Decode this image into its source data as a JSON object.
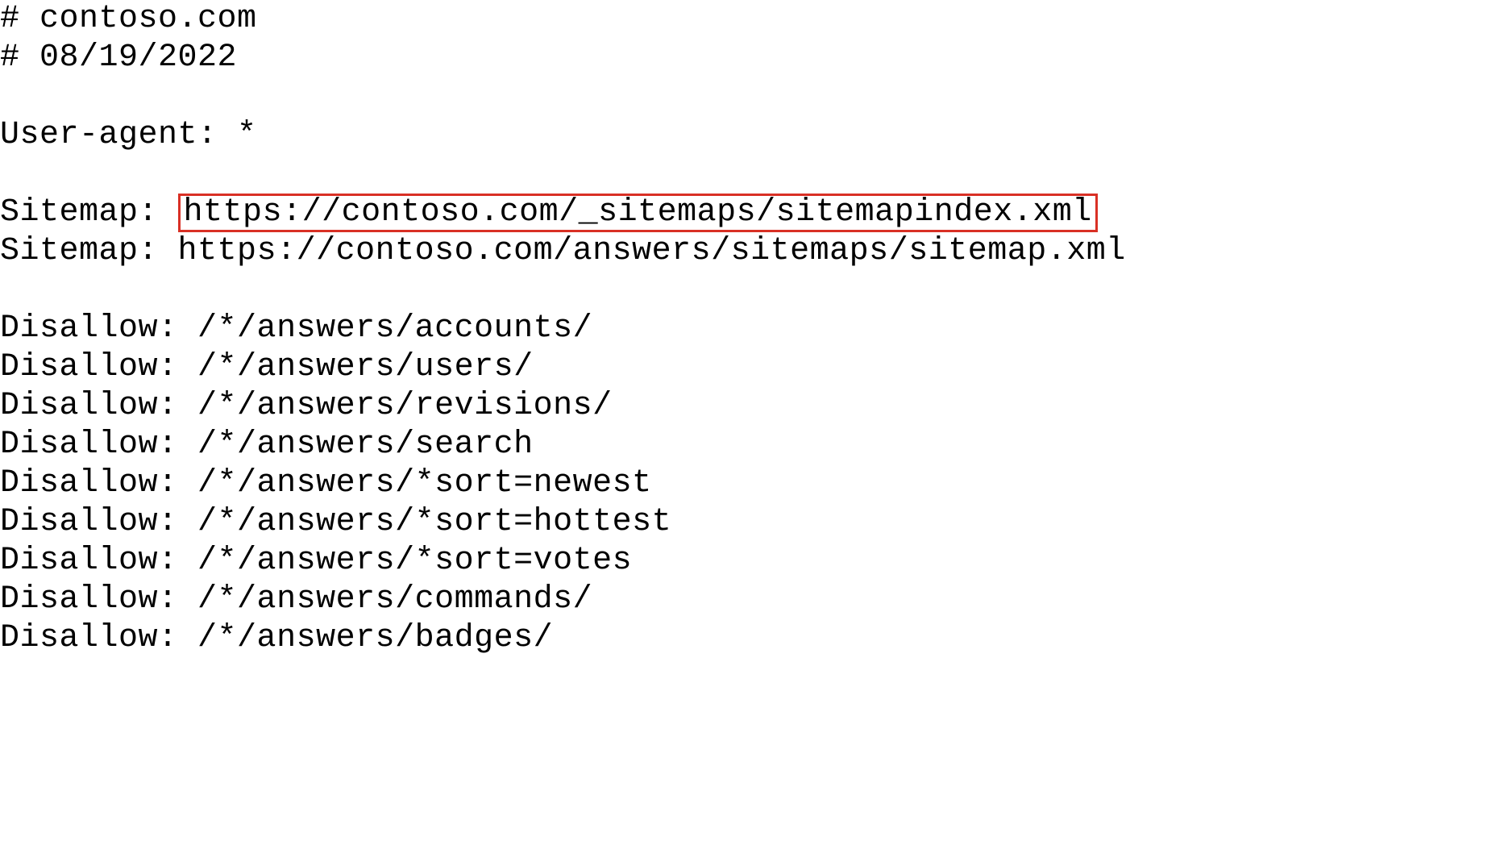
{
  "comments": {
    "line1": "# contoso.com",
    "line2": "# 08/19/2022"
  },
  "userAgent": {
    "label": "User-agent: ",
    "value": "*"
  },
  "sitemaps": {
    "label": "Sitemap: ",
    "entry1": "https://contoso.com/_sitemaps/sitemapindex.xml",
    "entry2": "https://contoso.com/answers/sitemaps/sitemap.xml"
  },
  "disallow": {
    "label": "Disallow: ",
    "paths": {
      "p1": "/*/answers/accounts/",
      "p2": "/*/answers/users/",
      "p3": "/*/answers/revisions/",
      "p4": "/*/answers/search",
      "p5": "/*/answers/*sort=newest",
      "p6": "/*/answers/*sort=hottest",
      "p7": "/*/answers/*sort=votes",
      "p8": "/*/answers/commands/",
      "p9": "/*/answers/badges/"
    }
  }
}
